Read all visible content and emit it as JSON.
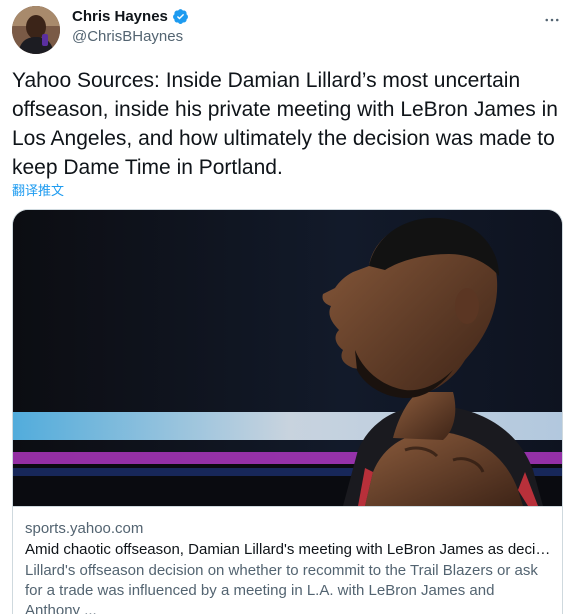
{
  "author": {
    "display_name": "Chris Haynes",
    "handle": "@ChrisBHaynes",
    "verified": true
  },
  "tweet": {
    "text": "Yahoo Sources: Inside Damian Lillard’s most uncertain offseason, inside his private meeting with LeBron James in Los Angeles, and how ultimately the decision was made to keep Dame Time in Portland.",
    "translate_label": "翻译推文"
  },
  "card": {
    "domain": "sports.yahoo.com",
    "title": "Amid chaotic offseason, Damian Lillard's meeting with LeBron James as decisi...",
    "description": "Lillard's offseason decision on whether to recommit to the Trail Blazers or ask for a trade was influenced by a meeting in L.A. with LeBron James and Anthony ..."
  },
  "icons": {
    "verified": "verified-badge-icon",
    "more": "more-options-icon"
  },
  "colors": {
    "accent": "#1d9bf0",
    "secondary_text": "#536471",
    "border": "#cfd9de"
  }
}
